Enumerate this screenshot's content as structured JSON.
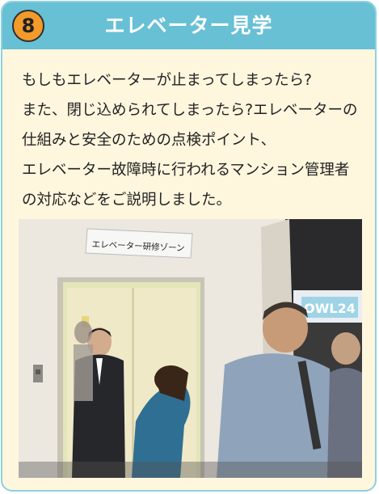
{
  "header": {
    "number": "8",
    "title": "エレベーター見学"
  },
  "description": "もしもエレベーターが止まってしまったら?\nまた、閉じ込められてしまったら?エレベーターの仕組みと安全のための点検ポイント、\nエレベーター故障時に行われるマンション管理者の対応などをご説明しました。",
  "photo": {
    "sign_text": "エレベーター研修ゾーン",
    "banner_text": "OWL24"
  }
}
